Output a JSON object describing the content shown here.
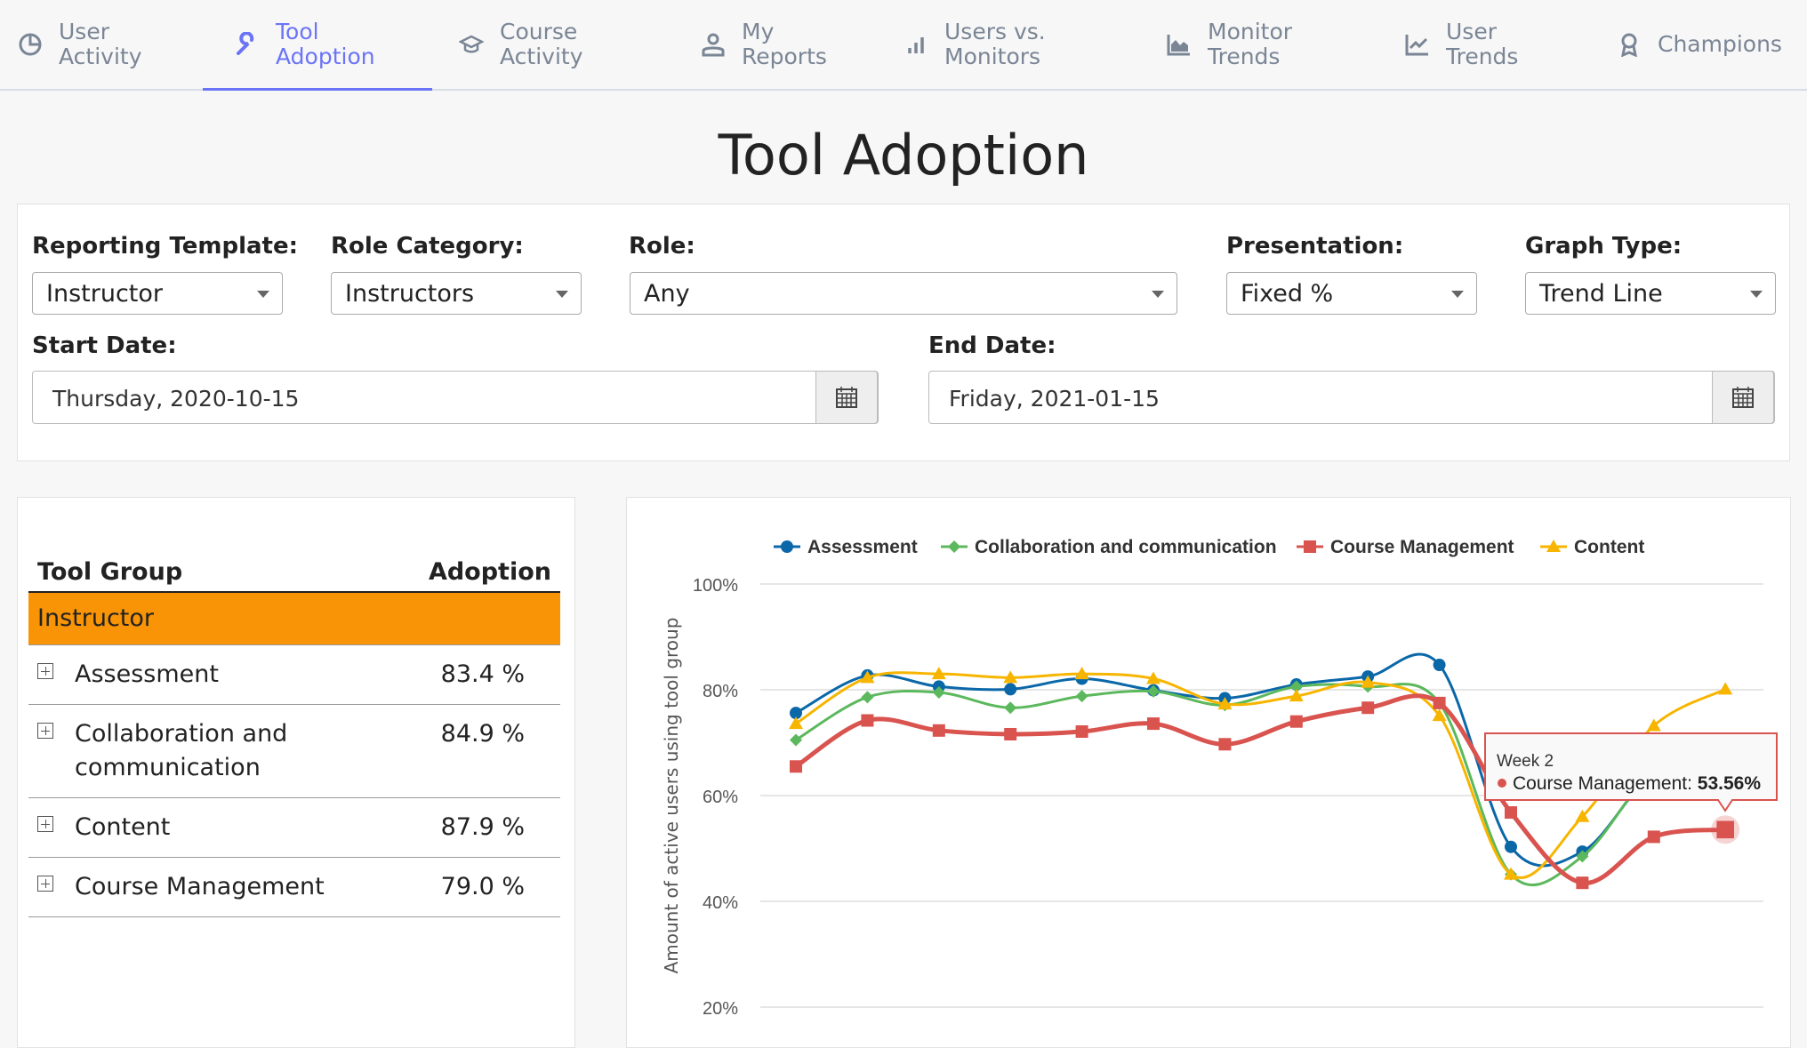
{
  "nav": {
    "tabs": [
      {
        "label1": "User",
        "label2": "Activity",
        "icon": "pie-chart-icon"
      },
      {
        "label1": "Tool",
        "label2": "Adoption",
        "icon": "wrench-icon",
        "active": true
      },
      {
        "label1": "Course",
        "label2": "Activity",
        "icon": "graduation-cap-icon"
      },
      {
        "label1": "My",
        "label2": "Reports",
        "icon": "user-icon"
      },
      {
        "label1": "Users vs.",
        "label2": "Monitors",
        "icon": "bar-chart-icon"
      },
      {
        "label1": "Monitor",
        "label2": "Trends",
        "icon": "area-chart-icon"
      },
      {
        "label1": "User",
        "label2": "Trends",
        "icon": "line-chart-icon"
      },
      {
        "label1": "Champions",
        "label2": "",
        "icon": "award-icon"
      }
    ]
  },
  "page": {
    "title": "Tool Adoption"
  },
  "filters": {
    "reporting_template": {
      "label": "Reporting Template:",
      "value": "Instructor"
    },
    "role_category": {
      "label": "Role Category:",
      "value": "Instructors"
    },
    "role": {
      "label": "Role:",
      "value": "Any"
    },
    "presentation": {
      "label": "Presentation:",
      "value": "Fixed %"
    },
    "graph_type": {
      "label": "Graph Type:",
      "value": "Trend Line"
    },
    "start_date": {
      "label": "Start Date:",
      "value": "Thursday, 2020-10-15"
    },
    "end_date": {
      "label": "End Date:",
      "value": "Friday, 2021-01-15"
    }
  },
  "table": {
    "headers": [
      "Tool Group",
      "Adoption"
    ],
    "group": "Instructor",
    "rows": [
      {
        "name": "Assessment",
        "value": "83.4 %"
      },
      {
        "name": "Collaboration and communication",
        "value": "84.9 %"
      },
      {
        "name": "Content",
        "value": "87.9 %"
      },
      {
        "name": "Course Management",
        "value": "79.0 %"
      }
    ]
  },
  "chart_data": {
    "type": "line",
    "ylabel": "Amount of active users using tool group",
    "ylim": [
      20,
      100
    ],
    "yticks": [
      "20%",
      "40%",
      "60%",
      "80%",
      "100%"
    ],
    "grid": true,
    "legend": "top",
    "series": [
      {
        "name": "Assessment",
        "color": "#0a67a8",
        "marker": "circle",
        "values": [
          75.6,
          82.7,
          80.6,
          80.1,
          82.1,
          79.9,
          78.4,
          81.0,
          82.5,
          84.7,
          50.3,
          49.4,
          64.4,
          67.9
        ]
      },
      {
        "name": "Collaboration and communication",
        "color": "#5cb85c",
        "marker": "diamond",
        "values": [
          70.5,
          78.6,
          79.5,
          76.6,
          78.8,
          79.7,
          77.1,
          80.6,
          80.6,
          77.5,
          45.1,
          48.5,
          64.9,
          69.9
        ]
      },
      {
        "name": "Course Management",
        "color": "#d9534f",
        "marker": "square",
        "values": [
          65.5,
          74.2,
          72.3,
          71.6,
          72.1,
          73.6,
          69.7,
          74.0,
          76.6,
          77.5,
          56.8,
          43.5,
          52.2,
          53.56
        ]
      },
      {
        "name": "Content",
        "color": "#f7b500",
        "marker": "triangle",
        "values": [
          73.6,
          82.3,
          83.0,
          82.3,
          83.0,
          82.1,
          77.3,
          78.8,
          81.4,
          75.1,
          45.1,
          56.0,
          73.2,
          80.1
        ]
      }
    ],
    "tooltip": {
      "title": "Week 2",
      "series": "Course Management: ",
      "value": "53.56%"
    }
  }
}
